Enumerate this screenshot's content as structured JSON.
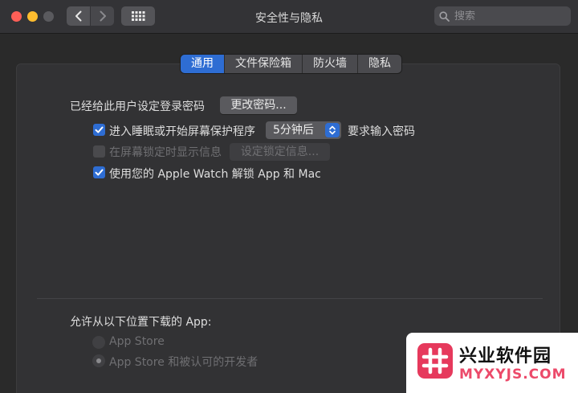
{
  "window": {
    "title": "安全性与隐私",
    "search_placeholder": "搜索"
  },
  "tabs": [
    {
      "label": "通用",
      "active": true
    },
    {
      "label": "文件保险箱",
      "active": false
    },
    {
      "label": "防火墙",
      "active": false
    },
    {
      "label": "隐私",
      "active": false
    }
  ],
  "general": {
    "password_label": "已经给此用户设定登录密码",
    "change_password_button": "更改密码...",
    "require_password": {
      "checked": true,
      "label": "进入睡眠或开始屏幕保护程序",
      "delay_value": "5分钟后",
      "suffix": "要求输入密码"
    },
    "lock_message": {
      "checked": false,
      "enabled": false,
      "label": "在屏幕锁定时显示信息",
      "button": "设定锁定信息..."
    },
    "apple_watch": {
      "checked": true,
      "label": "使用您的 Apple Watch 解锁 App 和 Mac"
    }
  },
  "downloads": {
    "heading": "允许从以下位置下载的 App:",
    "options": [
      {
        "label": "App Store",
        "selected": false
      },
      {
        "label": "App Store 和被认可的开发者",
        "selected": true
      }
    ]
  },
  "watermark": {
    "title": "兴业软件园",
    "subtitle": "MYXYJS.COM"
  },
  "colors": {
    "accent": "#2e6dd3",
    "close": "#fe5f57",
    "minimize": "#febc2e",
    "watermark_brand": "#e6395c"
  },
  "icons": {
    "back": "chevron-left-icon",
    "forward": "chevron-right-icon",
    "grid": "grid-icon",
    "search": "search-icon",
    "select_arrows": "chevron-updown-icon",
    "checkmark": "checkmark-icon"
  }
}
